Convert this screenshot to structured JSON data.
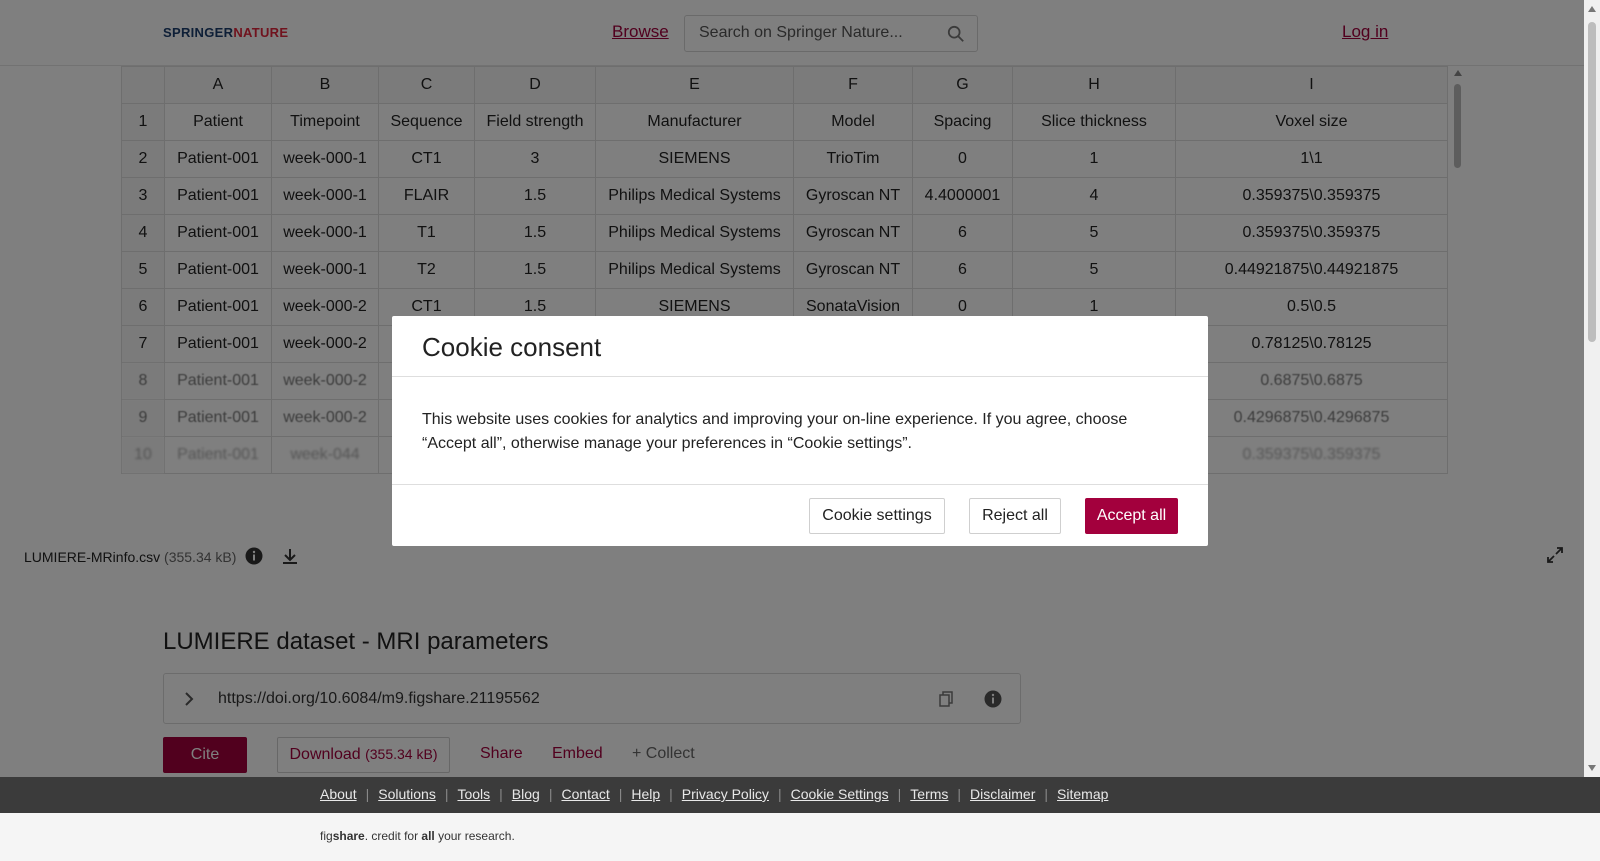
{
  "header": {
    "logo_main": "SPRINGER",
    "logo_accent": "NATURE",
    "browse_label": "Browse",
    "search_placeholder": "Search on Springer Nature...",
    "login_label": "Log in"
  },
  "sheet": {
    "columns": [
      "",
      "A",
      "B",
      "C",
      "D",
      "E",
      "F",
      "G",
      "H",
      "I"
    ],
    "rows": [
      [
        "1",
        "Patient",
        "Timepoint",
        "Sequence",
        "Field strength",
        "Manufacturer",
        "Model",
        "Spacing",
        "Slice thickness",
        "Voxel size"
      ],
      [
        "2",
        "Patient-001",
        "week-000-1",
        "CT1",
        "3",
        "SIEMENS",
        "TrioTim",
        "0",
        "1",
        "1\\1"
      ],
      [
        "3",
        "Patient-001",
        "week-000-1",
        "FLAIR",
        "1.5",
        "Philips Medical Systems",
        "Gyroscan NT",
        "4.4000001",
        "4",
        "0.359375\\0.359375"
      ],
      [
        "4",
        "Patient-001",
        "week-000-1",
        "T1",
        "1.5",
        "Philips Medical Systems",
        "Gyroscan NT",
        "6",
        "5",
        "0.359375\\0.359375"
      ],
      [
        "5",
        "Patient-001",
        "week-000-1",
        "T2",
        "1.5",
        "Philips Medical Systems",
        "Gyroscan NT",
        "6",
        "5",
        "0.44921875\\0.44921875"
      ],
      [
        "6",
        "Patient-001",
        "week-000-2",
        "CT1",
        "1.5",
        "SIEMENS",
        "SonataVision",
        "0",
        "1",
        "0.5\\0.5"
      ],
      [
        "7",
        "Patient-001",
        "week-000-2",
        "",
        "",
        "",
        "",
        "",
        "",
        "0.78125\\0.78125"
      ],
      [
        "8",
        "Patient-001",
        "week-000-2",
        "",
        "",
        "",
        "",
        "",
        "",
        "0.6875\\0.6875"
      ],
      [
        "9",
        "Patient-001",
        "week-000-2",
        "",
        "",
        "",
        "",
        "",
        "",
        "0.4296875\\0.4296875"
      ],
      [
        "10",
        "Patient-001",
        "week-044",
        "",
        "",
        "",
        "",
        "",
        "",
        "0.359375\\0.359375"
      ]
    ],
    "file_name": "LUMIERE-MRinfo.csv",
    "file_size": "(355.34 kB)"
  },
  "main": {
    "title": "LUMIERE dataset - MRI parameters",
    "doi": "https://doi.org/10.6084/m9.figshare.21195562",
    "cite_label": "Cite",
    "download_label": "Download",
    "download_size": "(355.34 kB)",
    "share_label": "Share",
    "embed_label": "Embed",
    "collect_label": "+ Collect"
  },
  "footer": {
    "links": [
      "About",
      "Solutions",
      "Tools",
      "Blog",
      "Contact",
      "Help",
      "Privacy Policy",
      "Cookie Settings",
      "Terms",
      "Disclaimer",
      "Sitemap"
    ],
    "tagline_fig": "fig",
    "tagline_share": "share",
    "tagline_mid": ". credit for ",
    "tagline_all": "all",
    "tagline_end": " your research."
  },
  "cookie_modal": {
    "title": "Cookie consent",
    "text": "This website uses cookies for analytics and improving your on-line experience. If you agree, choose “Accept all”, otherwise manage your preferences in “Cookie settings”.",
    "settings_label": "Cookie settings",
    "reject_label": "Reject all",
    "accept_label": "Accept all"
  },
  "colors": {
    "brand": "#a3003d",
    "footer_bg": "#3b3b3b"
  }
}
